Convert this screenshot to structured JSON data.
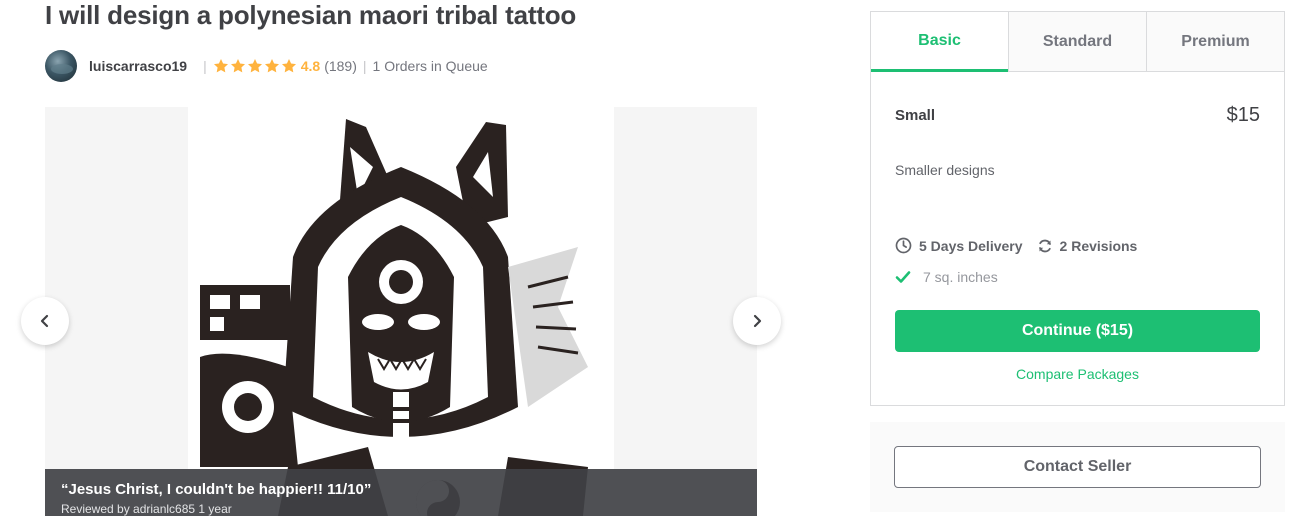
{
  "gig": {
    "title": "I will design a polynesian maori tribal tattoo"
  },
  "seller": {
    "username": "luiscarrasco19",
    "separator": "|",
    "rating": "4.8",
    "review_count": "(189)",
    "queue": "1 Orders in Queue",
    "star_count": 5
  },
  "gallery": {
    "quote": "“Jesus Christ, I couldn't be happier!! 11/10”",
    "reviewer": "Reviewed by adrianlc685 1 year"
  },
  "package": {
    "tabs": [
      {
        "label": "Basic",
        "active": true
      },
      {
        "label": "Standard",
        "active": false
      },
      {
        "label": "Premium",
        "active": false
      }
    ],
    "name": "Small",
    "price": "$15",
    "description": "Smaller designs",
    "delivery": "5 Days Delivery",
    "revisions": "2 Revisions",
    "feature": "7 sq. inches",
    "continue_label": "Continue ($15)",
    "compare_label": "Compare Packages"
  },
  "contact": {
    "button_label": "Contact Seller"
  },
  "colors": {
    "accent": "#1dbf73",
    "star": "#ffb33e",
    "text": "#404145"
  },
  "icons": [
    "chevron-left-icon",
    "chevron-right-icon",
    "star-icon",
    "clock-icon",
    "refresh-icon",
    "check-icon"
  ]
}
